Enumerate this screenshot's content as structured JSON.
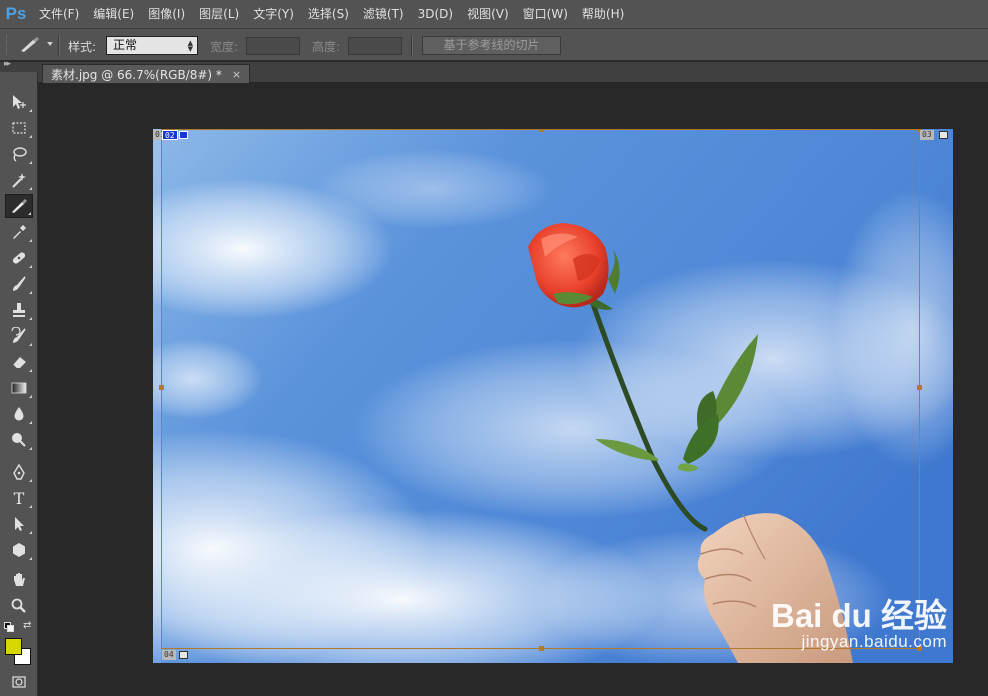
{
  "app": {
    "logo": "Ps",
    "menu": [
      "文件(F)",
      "编辑(E)",
      "图像(I)",
      "图层(L)",
      "文字(Y)",
      "选择(S)",
      "滤镜(T)",
      "3D(D)",
      "视图(V)",
      "窗口(W)",
      "帮助(H)"
    ]
  },
  "options": {
    "tool_icon": "slice-tool-icon",
    "style_label": "样式:",
    "style_value": "正常",
    "width_label": "宽度:",
    "height_label": "高度:",
    "slices_button": "基于参考线的切片"
  },
  "document": {
    "tab_title": "素材.jpg @ 66.7%(RGB/8#) *",
    "close_glyph": "×"
  },
  "slices": {
    "label_01": "01",
    "label_02": "02",
    "label_03": "03",
    "label_04": "04"
  },
  "watermark": {
    "main": "Bai du 经验",
    "sub": "jingyan.baidu.com"
  },
  "colors": {
    "foreground": "#d6d700",
    "background": "#ffffff",
    "guide": "#b07a2a"
  }
}
